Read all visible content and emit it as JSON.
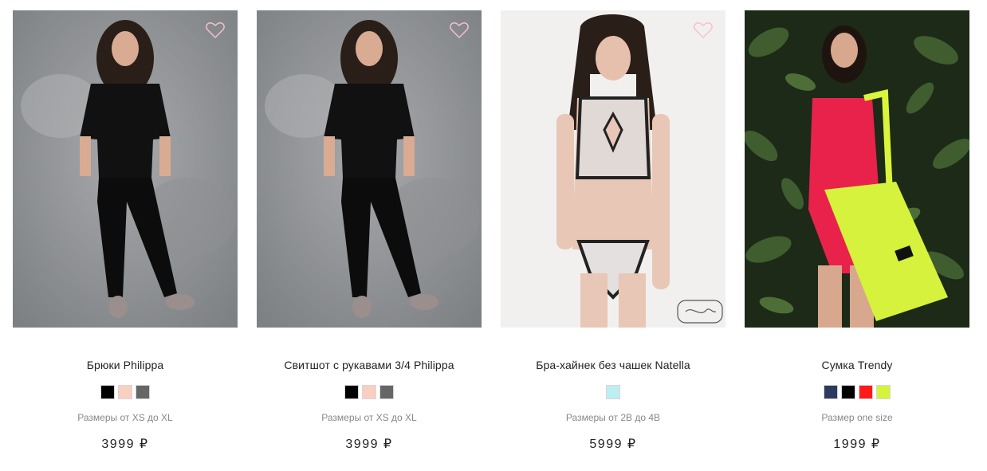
{
  "products": [
    {
      "name": "Брюки Philippa",
      "sizes": "Размеры от XS до XL",
      "price": "3999 ₽",
      "swatches": [
        "#000000",
        "#f9cfc2",
        "#666666"
      ],
      "wishlist_icon": "heart-outline-icon"
    },
    {
      "name": "Свитшот с рукавами 3/4 Philippa",
      "sizes": "Размеры от XS до XL",
      "price": "3999 ₽",
      "swatches": [
        "#000000",
        "#f9cfc2",
        "#666666"
      ],
      "wishlist_icon": "heart-outline-icon"
    },
    {
      "name": "Бра-хайнек без чашек Natella",
      "sizes": "Размеры от 2B до 4B",
      "price": "5999 ₽",
      "swatches": [
        "#bdeef1"
      ],
      "wishlist_icon": "heart-outline-icon"
    },
    {
      "name": "Сумка Trendy",
      "sizes": "Размер one size",
      "price": "1999 ₽",
      "swatches": [
        "#2c3a60",
        "#000000",
        "#ff1a1a",
        "#d6f23c"
      ],
      "wishlist_icon": "heart-outline-icon"
    }
  ],
  "colors": {
    "heart_stroke": "#f3c2cb",
    "text": "#222222",
    "muted": "#888888"
  }
}
